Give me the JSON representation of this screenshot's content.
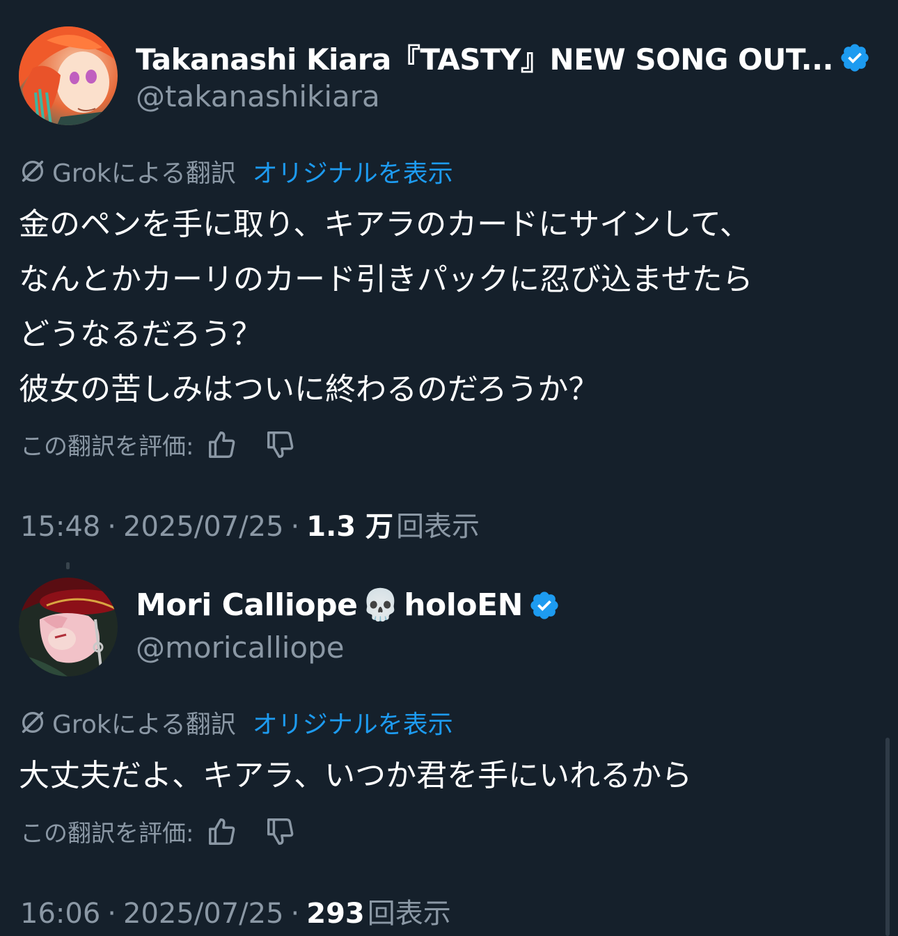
{
  "colors": {
    "background": "#15202b",
    "text_primary": "#ffffff",
    "text_secondary": "#8b98a5",
    "link": "#1d9bf0",
    "verified_badge": "#1d9bf0"
  },
  "posts": [
    {
      "display_name": "Takanashi Kiara『TASTY』NEW SONG OUT...",
      "handle": "@takanashikiara",
      "verified": true,
      "translation": {
        "icon": "grok-icon",
        "label": "Grokによる翻訳",
        "show_original": "オリジナルを表示"
      },
      "text": "金のペンを手に取り、キアラのカードにサインして、\nなんとかカーリのカード引きパックに忍び込ませたら\nどうなるだろう？\n彼女の苦しみはついに終わるのだろうか？",
      "rate_label": "この翻訳を評価:",
      "time": "15:48",
      "date": "2025/07/25",
      "views_count": "1.3 万",
      "views_label": "回表示"
    },
    {
      "display_name": "Mori Calliope",
      "emoji": "💀",
      "display_name_suffix": "holoEN",
      "handle": "@moricalliope",
      "verified": true,
      "translation": {
        "icon": "grok-icon",
        "label": "Grokによる翻訳",
        "show_original": "オリジナルを表示"
      },
      "text": "大丈夫だよ、キアラ、いつか君を手にいれるから",
      "rate_label": "この翻訳を評価:",
      "time": "16:06",
      "date": "2025/07/25",
      "views_count": "293",
      "views_label": "回表示"
    }
  ]
}
